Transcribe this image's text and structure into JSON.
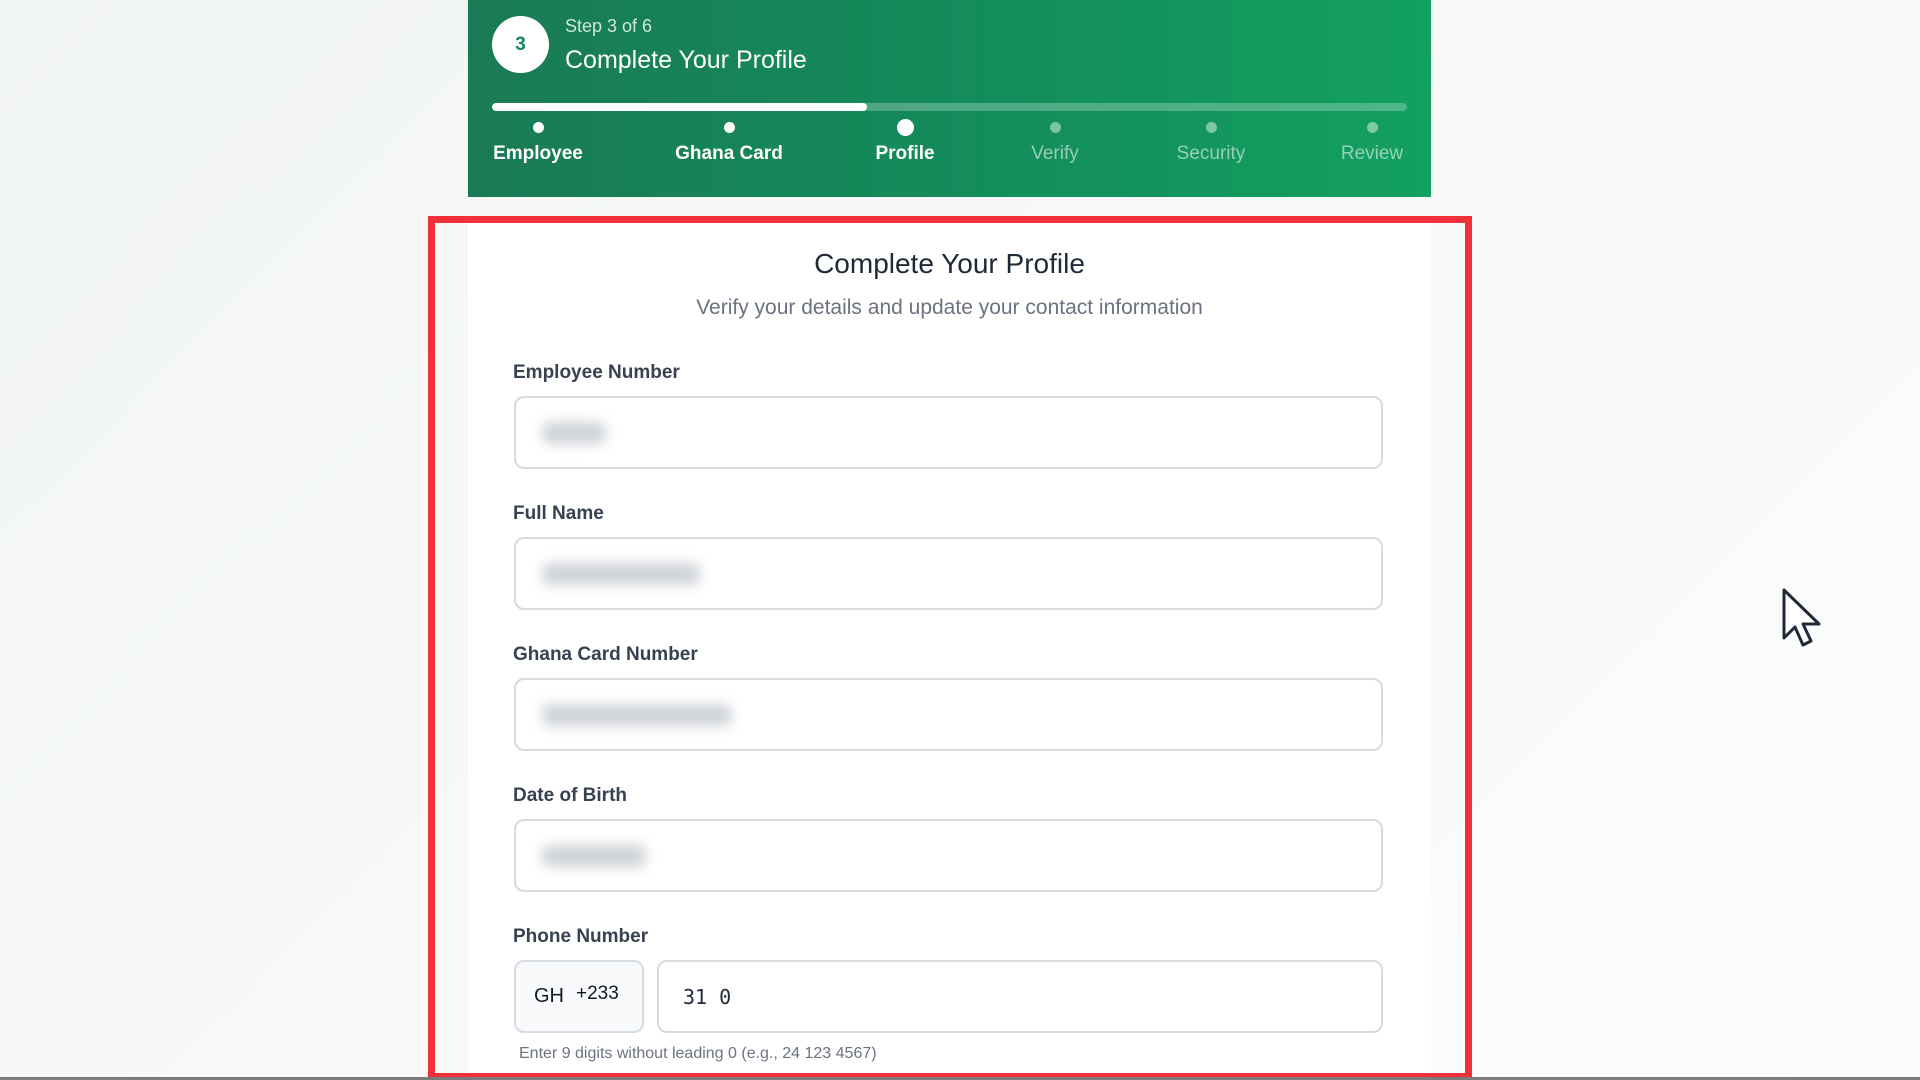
{
  "header": {
    "step_number": "3",
    "step_of": "Step 3 of 6",
    "title": "Complete Your Profile",
    "progress_fraction": 0.41,
    "steps": [
      {
        "label": "Employee",
        "state": "done"
      },
      {
        "label": "Ghana Card",
        "state": "done"
      },
      {
        "label": "Profile",
        "state": "active"
      },
      {
        "label": "Verify",
        "state": "pending"
      },
      {
        "label": "Security",
        "state": "pending"
      },
      {
        "label": "Review",
        "state": "pending"
      }
    ]
  },
  "form": {
    "title": "Complete Your Profile",
    "subtitle": "Verify your details and update your contact information",
    "fields": {
      "employee_number": {
        "label": "Employee Number"
      },
      "full_name": {
        "label": "Full Name"
      },
      "ghana_card_number": {
        "label": "Ghana Card Number"
      },
      "date_of_birth": {
        "label": "Date of Birth"
      },
      "phone_number": {
        "label": "Phone Number",
        "country_code": "GH",
        "dial_code": "+233",
        "value": "31 0",
        "helper": "Enter 9 digits without leading 0 (e.g., 24 123 4567)"
      }
    }
  },
  "colors": {
    "header_green": "#138d5c",
    "highlight_red": "#f1313a",
    "border": "#d6dbe1"
  }
}
